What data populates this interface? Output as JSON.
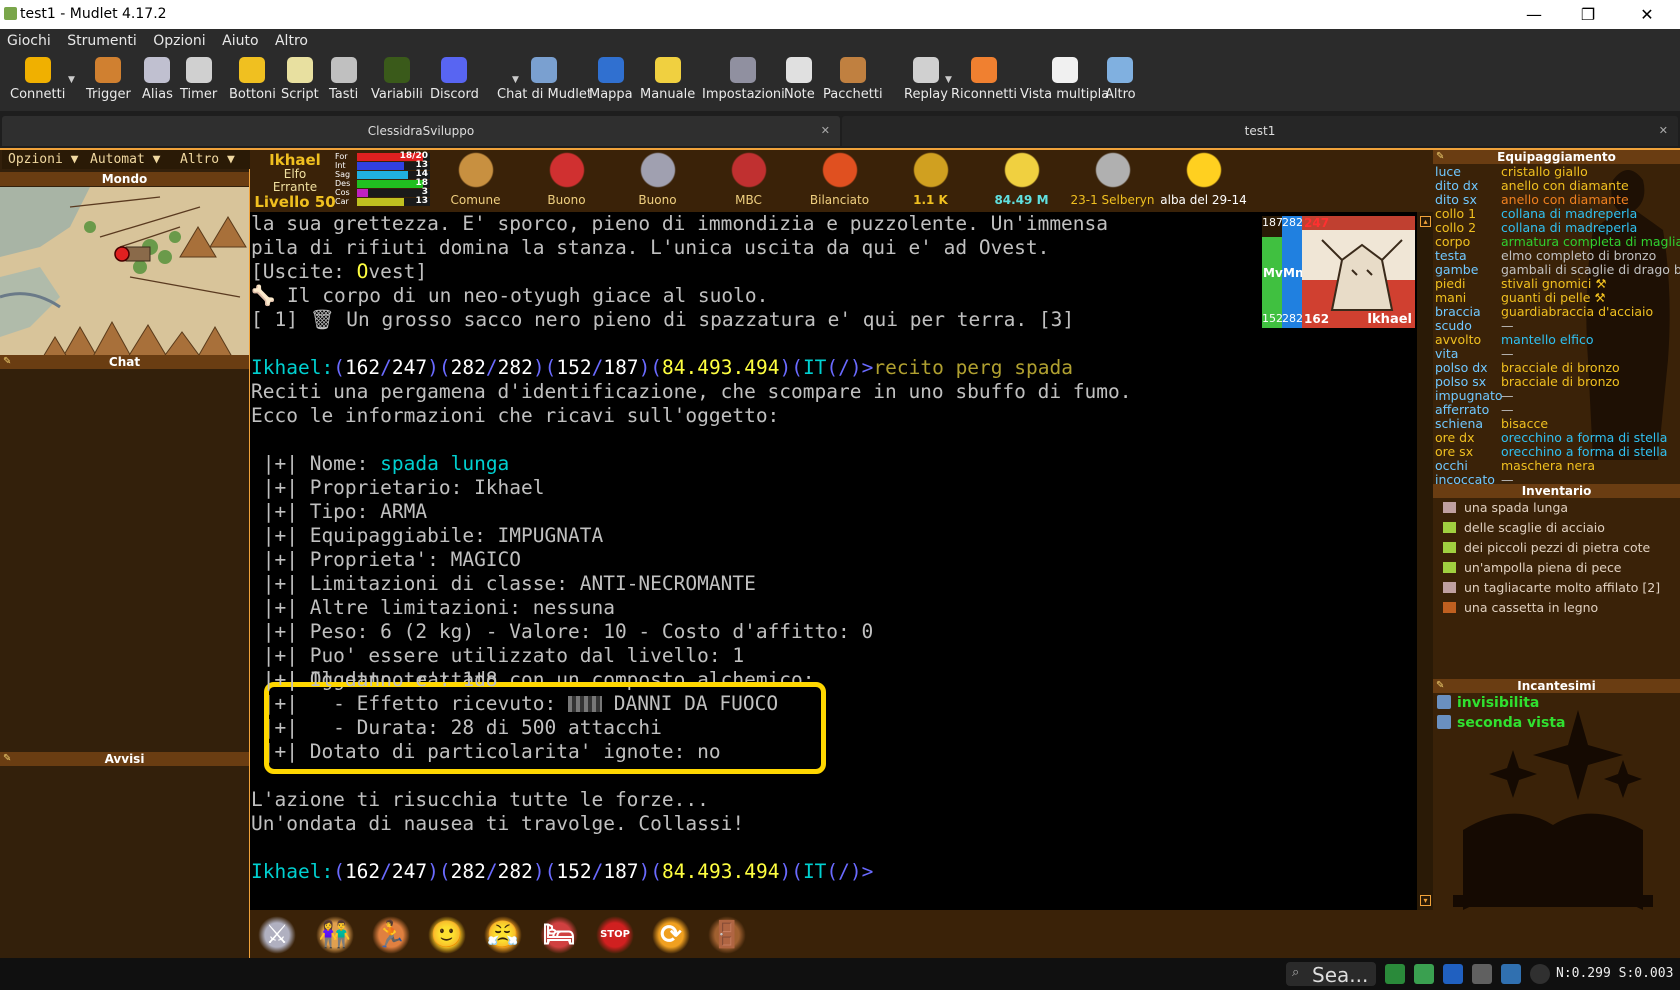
{
  "window": {
    "title": "test1 - Mudlet 4.17.2",
    "minimize": "—",
    "maximize": "❐",
    "close": "✕"
  },
  "menu": [
    "Giochi",
    "Strumenti",
    "Opzioni",
    "Aiuto",
    "Altro"
  ],
  "toolbar": [
    {
      "label": "Connetti",
      "icon": "connect-icon",
      "color": "#f0b000"
    },
    {
      "label": "Trigger",
      "icon": "trigger-icon",
      "color": "#d08030"
    },
    {
      "label": "Alias",
      "icon": "alias-icon",
      "color": "#c0c0d0"
    },
    {
      "label": "Timer",
      "icon": "timer-icon",
      "color": "#d0d0d0"
    },
    {
      "label": "Bottoni",
      "icon": "star-icon",
      "color": "#f0c020"
    },
    {
      "label": "Script",
      "icon": "script-icon",
      "color": "#e8e0a0"
    },
    {
      "label": "Tasti",
      "icon": "keyboard-icon",
      "color": "#c0c0c0"
    },
    {
      "label": "Variabili",
      "icon": "variables-icon",
      "color": "#3a5a1a"
    },
    {
      "label": "Discord",
      "icon": "discord-icon",
      "color": "#5865f2"
    },
    {
      "label": "Chat di Mudlet",
      "icon": "chat-icon",
      "color": "#7aa0d0"
    },
    {
      "label": "Mappa",
      "icon": "globe-icon",
      "color": "#3070d0"
    },
    {
      "label": "Manuale",
      "icon": "bulb-icon",
      "color": "#f0d040"
    },
    {
      "label": "Impostazioni",
      "icon": "wrench-icon",
      "color": "#9090a0"
    },
    {
      "label": "Note",
      "icon": "notes-icon",
      "color": "#e0e0e0"
    },
    {
      "label": "Pacchetti",
      "icon": "package-icon",
      "color": "#c08040"
    },
    {
      "label": "Replay",
      "icon": "replay-icon",
      "color": "#d0d0d0"
    },
    {
      "label": "Riconnetti",
      "icon": "reconnect-icon",
      "color": "#f08030"
    },
    {
      "label": "Vista multipla",
      "icon": "multiview-icon",
      "color": "#f0f0f0"
    },
    {
      "label": "Altro",
      "icon": "about-icon",
      "color": "#80b0e0"
    }
  ],
  "tabs": [
    {
      "label": "ClessidraSviluppo",
      "close": "✕"
    },
    {
      "label": "test1",
      "close": "✕"
    }
  ],
  "left": {
    "dropdowns": [
      "Opzioni ▼",
      "Automat ▼",
      "Altro ▼"
    ],
    "panels": {
      "mondo": "Mondo",
      "chat": "Chat",
      "avvisi": "Avvisi"
    }
  },
  "character": {
    "name": "Ikhael",
    "race": "Elfo",
    "class": "Errante",
    "level": "Livello 50"
  },
  "attributes": [
    {
      "label": "For",
      "value": "18/20",
      "fill": 0.9,
      "color": "#e02020"
    },
    {
      "label": "Int",
      "value": "13",
      "fill": 0.65,
      "color": "#3040e0"
    },
    {
      "label": "Sag",
      "value": "14",
      "fill": 0.7,
      "color": "#20b0e0"
    },
    {
      "label": "Des",
      "value": "18",
      "fill": 0.9,
      "color": "#20c020"
    },
    {
      "label": "Cos",
      "value": "3",
      "fill": 0.15,
      "color": "#c020c0"
    },
    {
      "label": "Car",
      "value": "13",
      "fill": 0.65,
      "color": "#c0c020"
    }
  ],
  "stats": [
    {
      "label": "Comune",
      "icon": "dwarf-face-icon",
      "color": "#c89040",
      "textcolor": "#f0d080"
    },
    {
      "label": "Buono",
      "icon": "target-icon",
      "color": "#d03030",
      "textcolor": "#f0d080"
    },
    {
      "label": "Buono",
      "icon": "crossed-swords-icon",
      "color": "#a0a0b0",
      "textcolor": "#f0d080"
    },
    {
      "label": "MBC",
      "icon": "shield-icon",
      "color": "#c03030",
      "textcolor": "#f0d080"
    },
    {
      "label": "Bilanciato",
      "icon": "devil-face-icon",
      "color": "#e05020",
      "textcolor": "#f0d080"
    },
    {
      "label": "1.1 K",
      "icon": "money-bag-icon",
      "color": "#d0a020",
      "textcolor": "#f0c020"
    },
    {
      "label": "84.49 M",
      "icon": "stars-icon",
      "color": "#f0d040",
      "textcolor": "#60e0e0"
    },
    {
      "label": "23-1 Selberyn",
      "icon": "castle-icon",
      "color": "#b0b0b0",
      "textcolor": "#f0c020"
    },
    {
      "label": "alba del 29-14",
      "icon": "sun-icon",
      "color": "#ffd020",
      "textcolor": "#ffffff"
    }
  ],
  "vitals": {
    "mv_max": "187",
    "mn_max": "282",
    "hp_max": "247",
    "mv": "152",
    "mn": "282",
    "hp": "162",
    "mv_label": "Mv",
    "mn_label": "Mn",
    "portrait_name": "Ikhael",
    "mv_fill": 0.81,
    "mn_fill": 1.0
  },
  "console": {
    "room_line1": "la sua grettezza. E' sporco, pieno di immondizia e puzzolente. Un'immensa",
    "room_line2": "pila di rifiuti domina la stanza. L'unica uscita da qui e' ad Ovest.",
    "exits_open": "[Uscite: ",
    "exit_O": "O",
    "exit_rest": "vest]",
    "corpse": "Il corpo di un neo-otyugh giace al suolo.",
    "sack_prefix": "[ 1]",
    "sack": "Un grosso sacco nero pieno di spazzatura e' qui per terra. [3]",
    "prompt_name": "Ikhael:",
    "hp": "162",
    "hp_max": "247",
    "mn": "282",
    "mn_max": "282",
    "mv": "152",
    "mv_max": "187",
    "xp": "84.493.494",
    "lang": "IT",
    "prompt_tail": "(/)>",
    "command": "recito perg spada",
    "msg1": "Reciti una pergamena d'identificazione, che scompare in uno sbuffo di fumo.",
    "msg2": "Ecco le informazioni che ricavi sull'oggetto:",
    "bar": " |+| ",
    "nome_label": "Nome: ",
    "nome_value": "spada lunga",
    "info": [
      "Proprietario: Ikhael",
      "Tipo: ARMA",
      "Equipaggiabile: IMPUGNATA",
      "Proprieta': MAGICO",
      "Limitazioni di classe: ANTI-NECROMANTE",
      "Altre limitazioni: nessuna",
      "Peso: 6 (2 kg) - Valore: 10 - Costo d'affitto: 0",
      "Puo' essere utilizzato dal livello: 1",
      "Il danno e': 1d8"
    ],
    "alch1": "Oggetto trattato con un composto alchemico:",
    "alch2a": "  - Effetto ricevuto: ",
    "alch2b": " DANNI DA FUOCO",
    "alch3": "  - Durata: 28 di 500 attacchi",
    "extra": "Dotato di particolarita' ignote: no",
    "msg3": "L'azione ti risucchia tutte le forze...",
    "msg4": "Un'ondata di nausea ti travolge. Collassi!"
  },
  "bottom_buttons": [
    {
      "name": "fight-button",
      "color": "#b0b0c0",
      "glyph": "⚔"
    },
    {
      "name": "group-button",
      "color": "#e0a050",
      "glyph": "👫"
    },
    {
      "name": "flee-button",
      "color": "#e08040",
      "glyph": "🏃"
    },
    {
      "name": "smile-button",
      "color": "#f0c020",
      "glyph": "🙂"
    },
    {
      "name": "rage-button",
      "color": "#f0a020",
      "glyph": "😤"
    },
    {
      "name": "sleep-button",
      "color": "#d04040",
      "glyph": "🛏"
    },
    {
      "name": "stop-button",
      "color": "#d02020",
      "glyph": "STOP"
    },
    {
      "name": "refresh-button",
      "color": "#f0a020",
      "glyph": "⟳"
    },
    {
      "name": "door-button",
      "color": "#a06030",
      "glyph": "🚪"
    }
  ],
  "equipment": {
    "title": "Equipaggiamento",
    "rows": [
      {
        "slot": "luce",
        "item": "cristallo giallo",
        "slotcolor": "#70c8ff",
        "itemcolor": "#f0c020"
      },
      {
        "slot": "dito dx",
        "item": "anello con diamante",
        "slotcolor": "#70c8ff",
        "itemcolor": "#f0c020"
      },
      {
        "slot": "dito sx",
        "item": "anello con diamante",
        "slotcolor": "#70c8ff",
        "itemcolor": "#f08020"
      },
      {
        "slot": "collo 1",
        "item": "collana di madreperla",
        "slotcolor": "#f0c020",
        "itemcolor": "#30c0f0"
      },
      {
        "slot": "collo 2",
        "item": "collana di madreperla",
        "slotcolor": "#f0c020",
        "itemcolor": "#30c0f0"
      },
      {
        "slot": "corpo",
        "item": "armatura completa di maglia",
        "slotcolor": "#f0c020",
        "itemcolor": "#30d030"
      },
      {
        "slot": "testa",
        "item": "elmo completo di bronzo",
        "slotcolor": "#70c8ff",
        "itemcolor": "#c0c0c0"
      },
      {
        "slot": "gambe",
        "item": "gambali di scaglie di drago b",
        "slotcolor": "#70c8ff",
        "itemcolor": "#c0c0c0"
      },
      {
        "slot": "piedi",
        "item": "stivali gnomici ⚒",
        "slotcolor": "#f0c020",
        "itemcolor": "#f0c020"
      },
      {
        "slot": "mani",
        "item": "guanti di pelle ⚒",
        "slotcolor": "#f0c020",
        "itemcolor": "#f0c020"
      },
      {
        "slot": "braccia",
        "item": "guardiabraccia d'acciaio",
        "slotcolor": "#70c8ff",
        "itemcolor": "#f0c020"
      },
      {
        "slot": "scudo",
        "item": "—",
        "slotcolor": "#70c8ff",
        "itemcolor": "#c0c0c0"
      },
      {
        "slot": "avvolto",
        "item": "mantello elfico",
        "slotcolor": "#f0c020",
        "itemcolor": "#30c0f0"
      },
      {
        "slot": "vita",
        "item": "—",
        "slotcolor": "#70c8ff",
        "itemcolor": "#c0c0c0"
      },
      {
        "slot": "polso dx",
        "item": "bracciale di bronzo",
        "slotcolor": "#70c8ff",
        "itemcolor": "#f0c020"
      },
      {
        "slot": "polso sx",
        "item": "bracciale di bronzo",
        "slotcolor": "#70c8ff",
        "itemcolor": "#f0c020"
      },
      {
        "slot": "impugnato",
        "item": "—",
        "slotcolor": "#70c8ff",
        "itemcolor": "#c0c0c0"
      },
      {
        "slot": "afferrato",
        "item": "—",
        "slotcolor": "#70c8ff",
        "itemcolor": "#c0c0c0"
      },
      {
        "slot": "schiena",
        "item": "bisacce",
        "slotcolor": "#70c8ff",
        "itemcolor": "#f0c020"
      },
      {
        "slot": "ore dx",
        "item": "orecchino a forma di stella",
        "slotcolor": "#f0c020",
        "itemcolor": "#30c0f0"
      },
      {
        "slot": "ore sx",
        "item": "orecchino a forma di stella",
        "slotcolor": "#f0c020",
        "itemcolor": "#30c0f0"
      },
      {
        "slot": "occhi",
        "item": "maschera nera",
        "slotcolor": "#70c8ff",
        "itemcolor": "#f0c020"
      },
      {
        "slot": "incoccato",
        "item": "—",
        "slotcolor": "#70c8ff",
        "itemcolor": "#c0c0c0"
      }
    ]
  },
  "inventory": {
    "title": "Inventario",
    "items": [
      {
        "label": "una spada lunga",
        "icon": "sword-icon",
        "color": "#c0a0a0"
      },
      {
        "label": "delle scaglie di acciaio",
        "icon": "potion-icon",
        "color": "#a0d040"
      },
      {
        "label": "dei piccoli pezzi di pietra cote",
        "icon": "potion-icon",
        "color": "#a0d040"
      },
      {
        "label": "un'ampolla piena di pece",
        "icon": "potion-icon",
        "color": "#a0d040"
      },
      {
        "label": "un tagliacarte molto affilato [2]",
        "icon": "sword-icon",
        "color": "#c0a0a0"
      },
      {
        "label": "una cassetta in legno",
        "icon": "vase-icon",
        "color": "#c06020"
      }
    ]
  },
  "spells": {
    "title": "Incantesimi",
    "items": [
      {
        "label": "invisibilita",
        "icon": "invisibility-icon"
      },
      {
        "label": "seconda vista",
        "icon": "sight-icon"
      }
    ]
  },
  "taskbar": {
    "search": "Sea...",
    "counter": "N:0.299 S:0.003"
  },
  "colors": {
    "accent": "#f0a23a",
    "highlight_box": "#ffd700",
    "panel_bg": "#33200b"
  }
}
